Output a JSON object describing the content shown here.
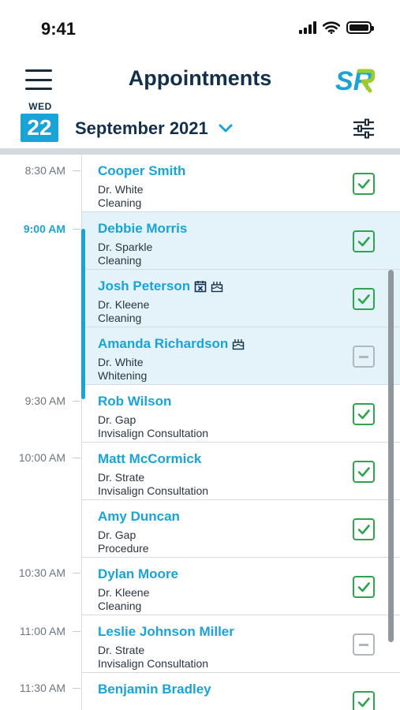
{
  "status_bar": {
    "time": "9:41"
  },
  "header": {
    "title": "Appointments",
    "logo_text": "SR"
  },
  "date": {
    "weekday": "WED",
    "day": "22",
    "month": "September 2021"
  },
  "colors": {
    "accent": "#1aa3d6",
    "title": "#13304a",
    "confirmed": "#2ea44f",
    "pending": "#b0b7bd",
    "highlight": "#e4f3fa"
  },
  "time_labels": [
    {
      "label": "8:30 AM",
      "current": false
    },
    {
      "label": "9:00 AM",
      "current": true
    },
    {
      "label": "9:30 AM",
      "current": false
    },
    {
      "label": "10:00 AM",
      "current": false
    },
    {
      "label": "10:30 AM",
      "current": false
    },
    {
      "label": "11:00 AM",
      "current": false
    },
    {
      "label": "11:30 AM",
      "current": false
    }
  ],
  "appointments": [
    {
      "name": "Cooper Smith",
      "doctor": "Dr. White",
      "type": "Cleaning",
      "status": "confirmed",
      "highlighted": false,
      "icons": []
    },
    {
      "name": "Debbie Morris",
      "doctor": "Dr. Sparkle",
      "type": "Cleaning",
      "status": "confirmed",
      "highlighted": true,
      "icons": []
    },
    {
      "name": "Josh Peterson",
      "doctor": "Dr. Kleene",
      "type": "Cleaning",
      "status": "confirmed",
      "highlighted": true,
      "icons": [
        "calendar-x-icon",
        "birthday-cake-icon"
      ]
    },
    {
      "name": "Amanda Richardson",
      "doctor": "Dr. White",
      "type": "Whitening",
      "status": "pending",
      "highlighted": true,
      "icons": [
        "birthday-cake-icon"
      ]
    },
    {
      "name": "Rob Wilson",
      "doctor": "Dr. Gap",
      "type": "Invisalign Consultation",
      "status": "confirmed",
      "highlighted": false,
      "icons": []
    },
    {
      "name": "Matt McCormick",
      "doctor": "Dr. Strate",
      "type": "Invisalign Consultation",
      "status": "confirmed",
      "highlighted": false,
      "icons": []
    },
    {
      "name": "Amy Duncan",
      "doctor": "Dr. Gap",
      "type": "Procedure",
      "status": "confirmed",
      "highlighted": false,
      "icons": []
    },
    {
      "name": "Dylan Moore",
      "doctor": "Dr. Kleene",
      "type": "Cleaning",
      "status": "confirmed",
      "highlighted": false,
      "icons": []
    },
    {
      "name": "Leslie Johnson Miller",
      "doctor": "Dr. Strate",
      "type": "Invisalign Consultation",
      "status": "pending",
      "highlighted": false,
      "icons": []
    },
    {
      "name": "Benjamin Bradley",
      "doctor": "",
      "type": "",
      "status": "confirmed",
      "highlighted": false,
      "icons": []
    }
  ]
}
